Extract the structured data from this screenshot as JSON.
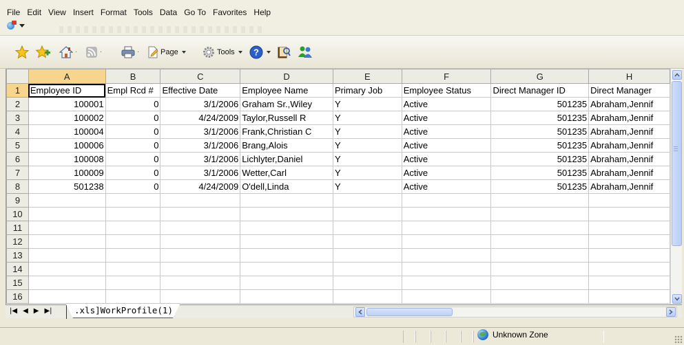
{
  "menubar": {
    "items": [
      "File",
      "Edit",
      "View",
      "Insert",
      "Format",
      "Tools",
      "Data",
      "Go To",
      "Favorites",
      "Help"
    ]
  },
  "toolbar": {
    "page_label": "Page",
    "tools_label": "Tools",
    "icons": [
      "favorites-star-icon",
      "add-favorite-icon",
      "home-icon",
      "feeds-icon",
      "print-icon",
      "page-icon",
      "tools-gear-icon",
      "help-icon",
      "research-icon",
      "messenger-icon"
    ]
  },
  "sheet": {
    "columns": [
      "A",
      "B",
      "C",
      "D",
      "E",
      "F",
      "G",
      "H"
    ],
    "active_column": "A",
    "active_row": "1",
    "headers": [
      "Employee ID",
      "Empl Rcd #",
      "Effective Date",
      "Employee Name",
      "Primary Job",
      "Employee Status",
      "Direct Manager ID",
      "Direct Manager"
    ],
    "rows": [
      [
        "100001",
        "0",
        "3/1/2006",
        "Graham Sr.,Wiley",
        "Y",
        "Active",
        "501235",
        "Abraham,Jennif"
      ],
      [
        "100002",
        "0",
        "4/24/2009",
        "Taylor,Russell R",
        "Y",
        "Active",
        "501235",
        "Abraham,Jennif"
      ],
      [
        "100004",
        "0",
        "3/1/2006",
        "Frank,Christian C",
        "Y",
        "Active",
        "501235",
        "Abraham,Jennif"
      ],
      [
        "100006",
        "0",
        "3/1/2006",
        "Brang,Alois",
        "Y",
        "Active",
        "501235",
        "Abraham,Jennif"
      ],
      [
        "100008",
        "0",
        "3/1/2006",
        "Lichlyter,Daniel",
        "Y",
        "Active",
        "501235",
        "Abraham,Jennif"
      ],
      [
        "100009",
        "0",
        "3/1/2006",
        "Wetter,Carl",
        "Y",
        "Active",
        "501235",
        "Abraham,Jennif"
      ],
      [
        "501238",
        "0",
        "4/24/2009",
        "O'dell,Linda",
        "Y",
        "Active",
        "501235",
        "Abraham,Jennif"
      ]
    ],
    "row_numbers": [
      "1",
      "2",
      "3",
      "4",
      "5",
      "6",
      "7",
      "8",
      "9",
      "10",
      "11",
      "12",
      "13",
      "14",
      "15",
      "16"
    ]
  },
  "tabs": {
    "sheet_tab": ".xls]WorkProfile(1)",
    "nav": [
      "|◀",
      "◀",
      "▶",
      "▶|"
    ]
  },
  "status": {
    "zone": "Unknown Zone"
  }
}
